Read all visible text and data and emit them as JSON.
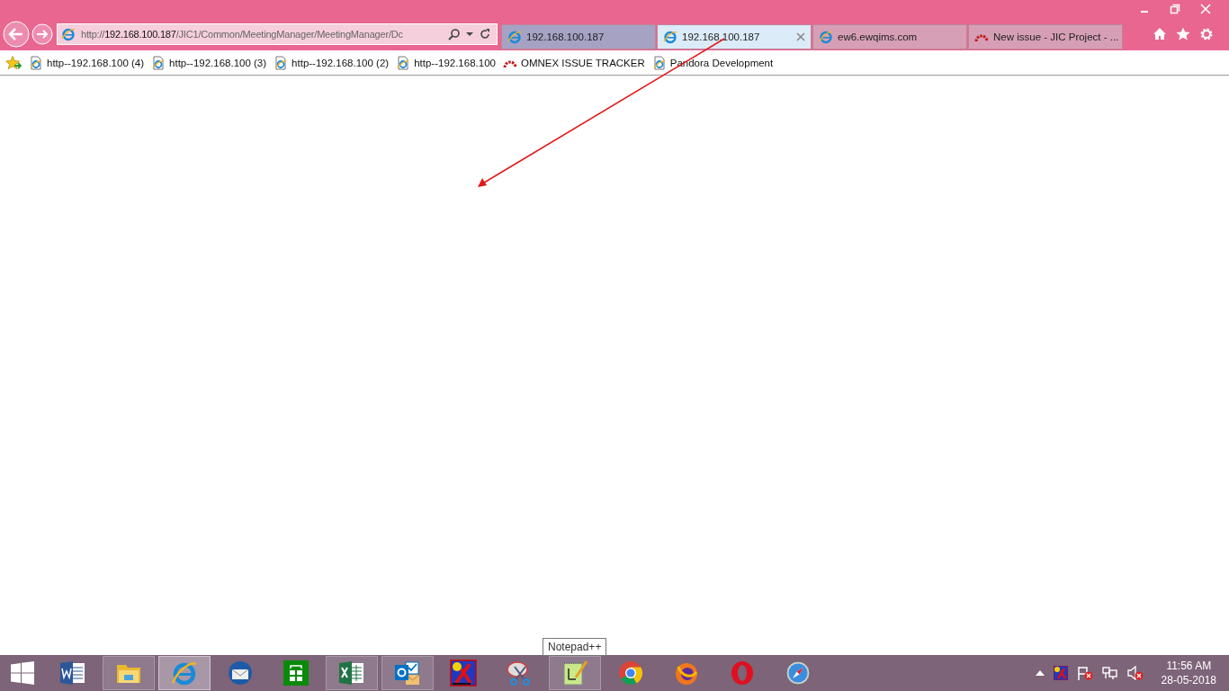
{
  "address_bar": {
    "scheme": "http://",
    "host": "192.168.100.187",
    "path": "/JIC1/Common/MeetingManager/MeetingManager/Dc"
  },
  "tabs": [
    {
      "title": "192.168.100.187",
      "kind": "ie",
      "selected": false,
      "hovered": true
    },
    {
      "title": "192.168.100.187",
      "kind": "ie",
      "selected": true,
      "hovered": false
    },
    {
      "title": "ew6.ewqims.com",
      "kind": "ie",
      "selected": false,
      "hovered": false
    },
    {
      "title": "New issue - JIC Project - ...",
      "kind": "tracker",
      "selected": false,
      "hovered": false
    }
  ],
  "favorites": [
    {
      "label": "http--192.168.100 (4)",
      "kind": "page"
    },
    {
      "label": "http--192.168.100 (3)",
      "kind": "page"
    },
    {
      "label": "http--192.168.100 (2)",
      "kind": "page"
    },
    {
      "label": "http--192.168.100",
      "kind": "page"
    },
    {
      "label": "OMNEX ISSUE TRACKER",
      "kind": "tracker"
    },
    {
      "label": "Pandora Development",
      "kind": "page"
    }
  ],
  "tooltip": "Notepad++",
  "taskbar": [
    {
      "kind": "word",
      "open": false,
      "selected": false
    },
    {
      "kind": "explorer",
      "open": true,
      "selected": false
    },
    {
      "kind": "ie",
      "open": true,
      "selected": true
    },
    {
      "kind": "thunderbird",
      "open": false,
      "selected": false
    },
    {
      "kind": "store",
      "open": false,
      "selected": false
    },
    {
      "kind": "excel",
      "open": true,
      "selected": false
    },
    {
      "kind": "outlook",
      "open": true,
      "selected": false
    },
    {
      "kind": "xapp",
      "open": false,
      "selected": false
    },
    {
      "kind": "snip",
      "open": false,
      "selected": false
    },
    {
      "kind": "notepad",
      "open": true,
      "selected": false
    },
    {
      "kind": "chrome",
      "open": false,
      "selected": false
    },
    {
      "kind": "firefox",
      "open": false,
      "selected": false
    },
    {
      "kind": "opera",
      "open": false,
      "selected": false
    },
    {
      "kind": "safari",
      "open": false,
      "selected": false
    }
  ],
  "tray": {
    "time": "11:56 AM",
    "date": "28-05-2018"
  }
}
